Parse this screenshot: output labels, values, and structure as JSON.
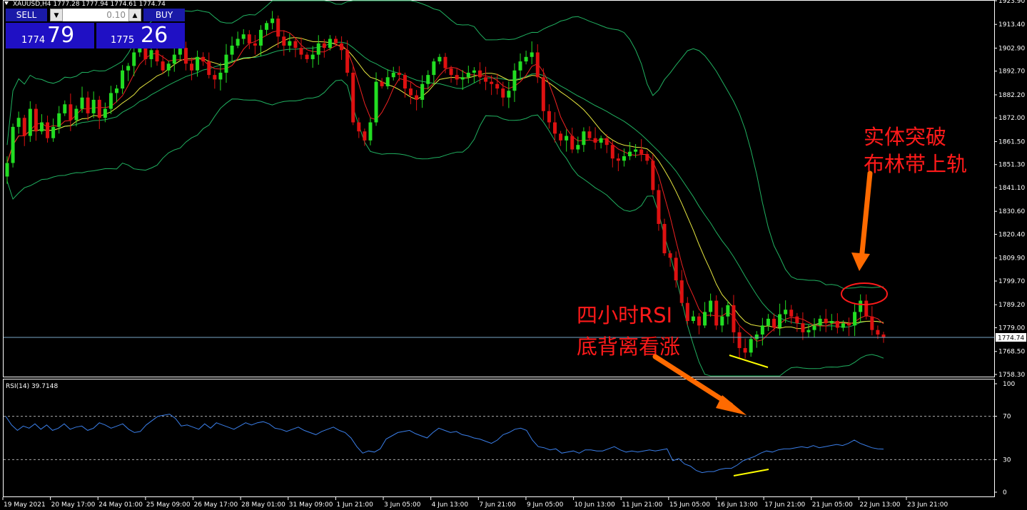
{
  "window": {
    "title": "XAUUSD,H4  1777.28 1777.94 1774.61 1774.74"
  },
  "trade_panel": {
    "sell_label": "SELL",
    "buy_label": "BUY",
    "lot_value": "0.10",
    "sell_price_small": "1774",
    "sell_price_big": "79",
    "buy_price_small": "1775",
    "buy_price_big": "26"
  },
  "colors": {
    "background": "#000000",
    "bull": "#22dd22",
    "bear": "#dd1111",
    "bands": "#20b060",
    "ma_fast": "#ee2222",
    "ma_slow": "#e8e840",
    "rsi": "#3a7ee8",
    "annotation": "#ff1a1a",
    "arrow": "#ff6a00",
    "divergence": "#ffff00"
  },
  "chart_data": [
    {
      "type": "candlestick",
      "title": "XAUUSD,H4  1777.28 1777.94 1774.61 1774.74",
      "symbol": "XAUUSD",
      "timeframe": "H4",
      "last": {
        "open": 1777.28,
        "high": 1777.94,
        "low": 1774.61,
        "close": 1774.74
      },
      "current_price_label": "1774.74",
      "y_ticks": [
        "1923.90",
        "1913.40",
        "1902.90",
        "1892.70",
        "1882.20",
        "1872.00",
        "1861.50",
        "1851.30",
        "1841.10",
        "1830.60",
        "1820.40",
        "1809.90",
        "1799.70",
        "1789.20",
        "1779.00",
        "1768.50",
        "1758.30"
      ],
      "ylim": [
        1756.0,
        1926.0
      ],
      "grid": false,
      "indicators": [
        "Bollinger Bands",
        "Moving Average (fast)",
        "Moving Average (slow)"
      ],
      "candles_close": [
        1852,
        1868,
        1872,
        1864,
        1876,
        1866,
        1870,
        1863,
        1868,
        1874,
        1878,
        1871,
        1876,
        1881,
        1874,
        1880,
        1872,
        1876,
        1883,
        1885,
        1893,
        1895,
        1901,
        1905,
        1898,
        1902,
        1897,
        1893,
        1896,
        1900,
        1903,
        1896,
        1893,
        1899,
        1897,
        1891,
        1889,
        1892,
        1900,
        1904,
        1907,
        1909,
        1905,
        1904,
        1911,
        1914,
        1916,
        1908,
        1904,
        1906,
        1903,
        1900,
        1898,
        1900,
        1905,
        1903,
        1907,
        1905,
        1902,
        1892,
        1870,
        1866,
        1862,
        1870,
        1888,
        1886,
        1890,
        1892,
        1891,
        1885,
        1882,
        1880,
        1887,
        1891,
        1897,
        1899,
        1894,
        1891,
        1889,
        1890,
        1892,
        1893,
        1890,
        1888,
        1887,
        1885,
        1881,
        1884,
        1893,
        1897,
        1899,
        1901,
        1890,
        1875,
        1870,
        1865,
        1862,
        1864,
        1858,
        1860,
        1866,
        1863,
        1861,
        1863,
        1860,
        1854,
        1853,
        1855,
        1857,
        1858,
        1856,
        1853,
        1840,
        1825,
        1812,
        1810,
        1800,
        1790,
        1782,
        1784,
        1780,
        1786,
        1791,
        1780,
        1784,
        1789,
        1777,
        1770,
        1768,
        1774,
        1776,
        1780,
        1783,
        1779,
        1785,
        1787,
        1784,
        1781,
        1777,
        1778,
        1780,
        1783,
        1781,
        1782,
        1779,
        1781,
        1780,
        1786,
        1791,
        1784,
        1778,
        1776,
        1774.74
      ],
      "x_tick_labels": [
        "19 May 2021",
        "20 May 17:00",
        "24 May 01:00",
        "25 May 09:00",
        "26 May 17:00",
        "28 May 01:00",
        "31 May 09:00",
        "1 Jun 21:00",
        "3 Jun 05:00",
        "4 Jun 13:00",
        "7 Jun 21:00",
        "9 Jun 05:00",
        "10 Jun 13:00",
        "11 Jun 21:00",
        "15 Jun 05:00",
        "16 Jun 13:00",
        "17 Jun 21:00",
        "21 Jun 05:00",
        "22 Jun 13:00",
        "23 Jun 21:00"
      ],
      "annotations": [
        "实体突破",
        "布林带上轨",
        "四小时RSI",
        "底背离看涨"
      ]
    },
    {
      "type": "line",
      "title": "RSI(14) 39.7148",
      "series": [
        {
          "name": "RSI(14)",
          "values": [
            70,
            62,
            57,
            61,
            59,
            63,
            58,
            62,
            57,
            59,
            63,
            58,
            60,
            61,
            57,
            59,
            64,
            62,
            59,
            61,
            63,
            58,
            55,
            56,
            62,
            66,
            70,
            71,
            72,
            68,
            61,
            62,
            60,
            58,
            63,
            59,
            64,
            62,
            60,
            58,
            61,
            64,
            62,
            64,
            65,
            63,
            59,
            58,
            56,
            58,
            60,
            57,
            55,
            53,
            56,
            58,
            60,
            57,
            55,
            50,
            42,
            36,
            38,
            37,
            40,
            49,
            52,
            55,
            56,
            57,
            54,
            52,
            50,
            55,
            59,
            57,
            55,
            56,
            53,
            52,
            50,
            49,
            47,
            45,
            48,
            53,
            55,
            58,
            59,
            57,
            48,
            42,
            41,
            39,
            40,
            36,
            37,
            38,
            36,
            39,
            39,
            38,
            38,
            40,
            42,
            39,
            37,
            38,
            37,
            38,
            39,
            38,
            39,
            40,
            29,
            31,
            26,
            24,
            20,
            18,
            19,
            19,
            21,
            22,
            22,
            25,
            29,
            31,
            33,
            36,
            38,
            37,
            39,
            40,
            40,
            41,
            42,
            41,
            43,
            41,
            42,
            43,
            44,
            43,
            45,
            48,
            45,
            43,
            41,
            40,
            39.7148
          ]
        }
      ],
      "ylim": [
        0,
        100
      ],
      "y_ticks": [
        "100",
        "70",
        "30",
        "0"
      ],
      "levels": [
        70,
        30
      ]
    }
  ]
}
